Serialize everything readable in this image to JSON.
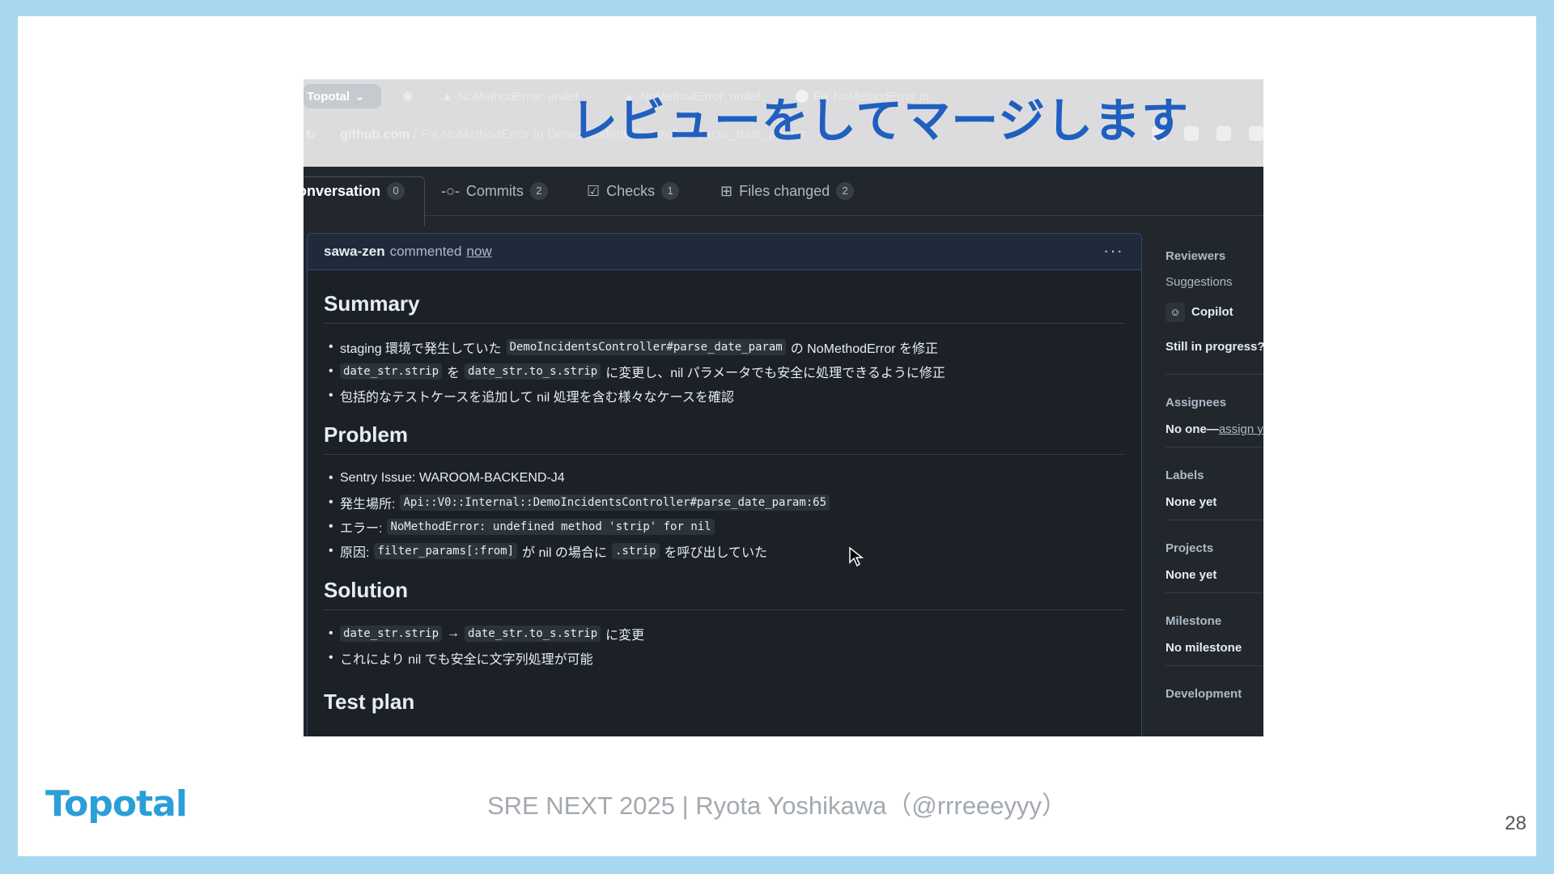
{
  "slide": {
    "headline": "レビューをしてマージします",
    "footer": "SRE NEXT 2025 | Ryota Yoshikawa（@rrreeeyyy）",
    "logo": "Topotal",
    "page_number": "28"
  },
  "browser": {
    "workspace": "Topotal",
    "tabs": [
      "NoMethodError: undef",
      "NoMethodError: undef",
      "Fix NoMethodError in"
    ],
    "url_domain": "github.com",
    "url_rest": "/ Fix NoMethodError in DemoIncidentsController#parse_date_param"
  },
  "pr_tabs": [
    {
      "label": "Conversation",
      "count": "0",
      "active": true
    },
    {
      "label": "Commits",
      "count": "2",
      "active": false
    },
    {
      "label": "Checks",
      "count": "1",
      "active": false
    },
    {
      "label": "Files changed",
      "count": "2",
      "active": false
    }
  ],
  "comment": {
    "author": "sawa-zen",
    "action": "commented",
    "time": "now",
    "summary_title": "Summary",
    "problem_title": "Problem",
    "solution_title": "Solution",
    "testplan_title": "Test plan",
    "summary": [
      {
        "a": "staging 環境で発生していた",
        "code": "DemoIncidentsController#parse_date_param",
        "b": "の NoMethodError を修正"
      },
      {
        "code1": "date_str.strip",
        "a": "を",
        "code2": "date_str.to_s.strip",
        "b": "に変更し、nil パラメータでも安全に処理できるように修正"
      },
      {
        "a": "包括的なテストケースを追加して nil 処理を含む様々なケースを確認"
      }
    ],
    "problem": [
      {
        "a": "Sentry Issue: WAROOM-BACKEND-J4"
      },
      {
        "a": "発生場所:",
        "code": "Api::V0::Internal::DemoIncidentsController#parse_date_param:65"
      },
      {
        "a": "エラー:",
        "code": "NoMethodError: undefined method 'strip' for nil"
      },
      {
        "a": "原因:",
        "code1": "filter_params[:from]",
        "b": "が nil の場合に",
        "code2": ".strip",
        "c": "を呼び出していた"
      }
    ],
    "solution": [
      {
        "code1": "date_str.strip",
        "arrow": "→",
        "code2": "date_str.to_s.strip",
        "b": "に変更"
      },
      {
        "a": "これにより nil でも安全に文字列処理が可能"
      }
    ]
  },
  "sidebar": {
    "reviewers_label": "Reviewers",
    "suggestions_label": "Suggestions",
    "copilot": "Copilot",
    "still_in_progress": "Still in progress?",
    "assignees_label": "Assignees",
    "assignees_value": "No one—",
    "assign_link": "assign y",
    "labels_label": "Labels",
    "labels_value": "None yet",
    "projects_label": "Projects",
    "projects_value": "None yet",
    "milestone_label": "Milestone",
    "milestone_value": "No milestone",
    "development_label": "Development"
  }
}
